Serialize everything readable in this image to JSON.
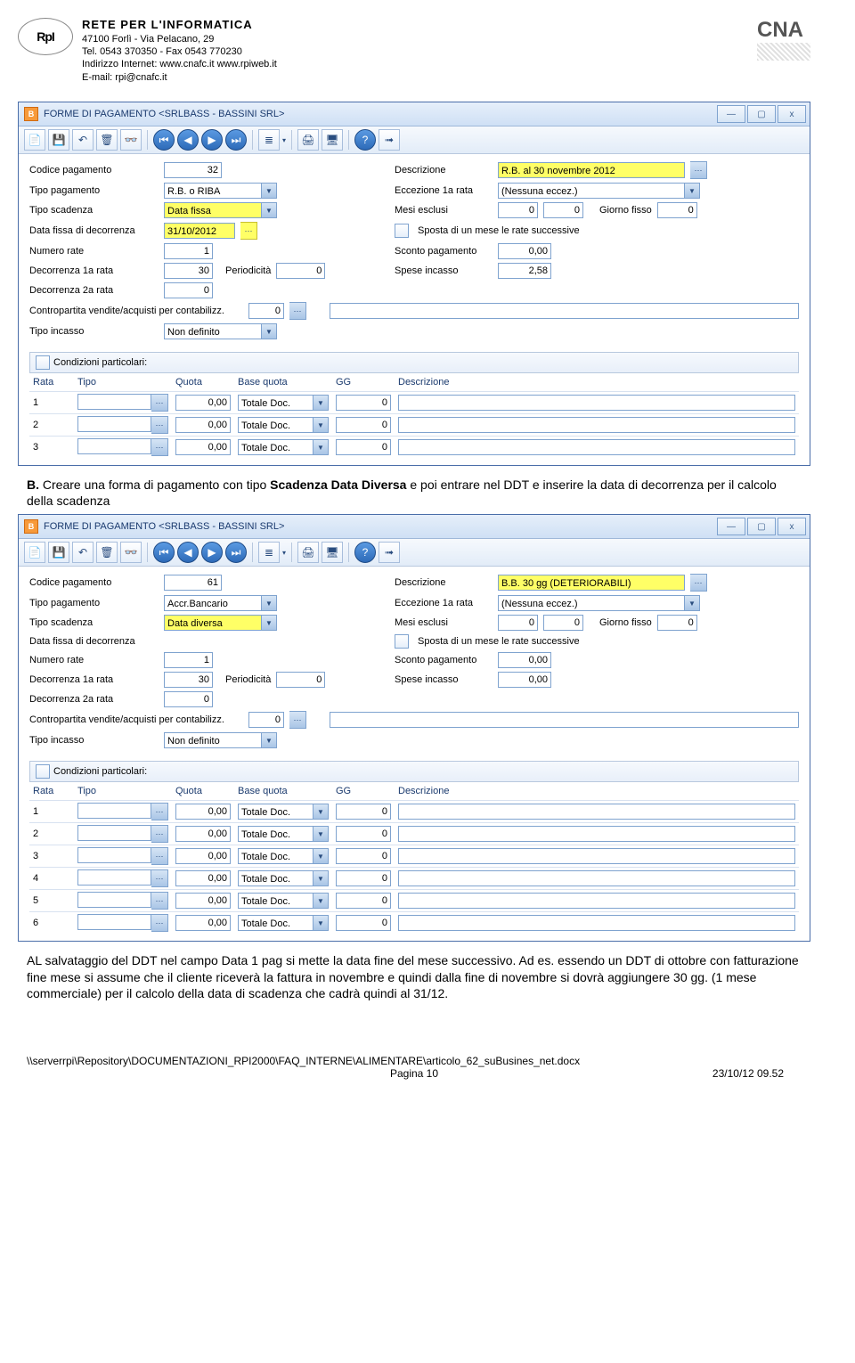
{
  "header": {
    "company": "RETE PER L'INFORMATICA",
    "addr1": "47100 Forlì - Via Pelacano, 29",
    "addr2": "Tel. 0543 370350 - Fax 0543 770230",
    "addr3": "Indirizzo Internet: www.cnafc.it www.rpiweb.it",
    "addr4": "E-mail: rpi@cnafc.it",
    "cna": "CNA"
  },
  "win1": {
    "title": "FORME DI PAGAMENTO <SRLBASS - BASSINI SRL>",
    "codice_pagamento": "32",
    "descrizione": "R.B. al 30 novembre 2012",
    "tipo_pagamento": "R.B. o RIBA",
    "eccezione_1a": "(Nessuna eccez.)",
    "tipo_scadenza": "Data fissa",
    "mesi_esc1": "0",
    "mesi_esc2": "0",
    "giorno_fisso": "0",
    "data_fissa": "31/10/2012",
    "sposta": "Sposta di un mese le rate successive",
    "num_rate": "1",
    "sconto_pag": "0,00",
    "dec_1a": "30",
    "periodicita": "0",
    "spese_incasso": "2,58",
    "dec_2a": "0",
    "contropartita": "0",
    "tipo_incasso": "Non definito",
    "cond_part": "Condizioni particolari:",
    "cols": {
      "rata": "Rata",
      "tipo": "Tipo",
      "quota": "Quota",
      "base": "Base quota",
      "gg": "GG",
      "desc": "Descrizione"
    },
    "rows": [
      {
        "n": "1",
        "quota": "0,00",
        "base": "Totale Doc.",
        "gg": "0"
      },
      {
        "n": "2",
        "quota": "0,00",
        "base": "Totale Doc.",
        "gg": "0"
      },
      {
        "n": "3",
        "quota": "0,00",
        "base": "Totale Doc.",
        "gg": "0"
      }
    ],
    "labels": {
      "codice": "Codice pagamento",
      "desc": "Descrizione",
      "tipo_pag": "Tipo pagamento",
      "ecc": "Eccezione 1a rata",
      "tipo_scad": "Tipo scadenza",
      "mesi": "Mesi esclusi",
      "gfisso": "Giorno fisso",
      "data_fissa": "Data fissa di decorrenza",
      "num_rate": "Numero rate",
      "sconto": "Sconto pagamento",
      "dec1": "Decorrenza 1a rata",
      "period": "Periodicità",
      "spese": "Spese incasso",
      "dec2": "Decorrenza 2a rata",
      "contro": "Contropartita vendite/acquisti per contabilizz.",
      "tipo_inc": "Tipo incasso"
    }
  },
  "paraB": {
    "prefix": "B.",
    "line1a": " Creare una forma di pagamento con tipo ",
    "bold1": "Scadenza Data Diversa",
    "line1b": " e poi entrare nel DDT e inserire la data di decorrenza per il calcolo della scadenza"
  },
  "win2": {
    "title": "FORME DI PAGAMENTO <SRLBASS - BASSINI SRL>",
    "codice_pagamento": "61",
    "descrizione": "B.B. 30 gg (DETERIORABILI)",
    "tipo_pagamento": "Accr.Bancario",
    "eccezione_1a": "(Nessuna eccez.)",
    "tipo_scadenza": "Data diversa",
    "mesi_esc1": "0",
    "mesi_esc2": "0",
    "giorno_fisso": "0",
    "sposta": "Sposta di un mese le rate successive",
    "num_rate": "1",
    "sconto_pag": "0,00",
    "dec_1a": "30",
    "periodicita": "0",
    "spese_incasso": "0,00",
    "dec_2a": "0",
    "contropartita": "0",
    "tipo_incasso": "Non definito",
    "cond_part": "Condizioni particolari:",
    "rows": [
      {
        "n": "1",
        "quota": "0,00",
        "base": "Totale Doc.",
        "gg": "0"
      },
      {
        "n": "2",
        "quota": "0,00",
        "base": "Totale Doc.",
        "gg": "0"
      },
      {
        "n": "3",
        "quota": "0,00",
        "base": "Totale Doc.",
        "gg": "0"
      },
      {
        "n": "4",
        "quota": "0,00",
        "base": "Totale Doc.",
        "gg": "0"
      },
      {
        "n": "5",
        "quota": "0,00",
        "base": "Totale Doc.",
        "gg": "0"
      },
      {
        "n": "6",
        "quota": "0,00",
        "base": "Totale Doc.",
        "gg": "0"
      }
    ]
  },
  "paraAL": "AL salvataggio del DDT nel campo Data 1 pag si mette la data fine del mese successivo. Ad es. essendo un DDT di ottobre con fatturazione fine mese si assume che il cliente riceverà la fattura in novembre e quindi dalla fine di novembre si dovrà aggiungere 30 gg. (1 mese commerciale) per il calcolo della data di scadenza che cadrà quindi al 31/12.",
  "footer": {
    "path": "\\\\serverrpi\\Repository\\DOCUMENTAZIONI_RPI2000\\FAQ_INTERNE\\ALIMENTARE\\articolo_62_suBusines_net.docx",
    "page": "Pagina 10",
    "date": "23/10/12 09.52"
  }
}
